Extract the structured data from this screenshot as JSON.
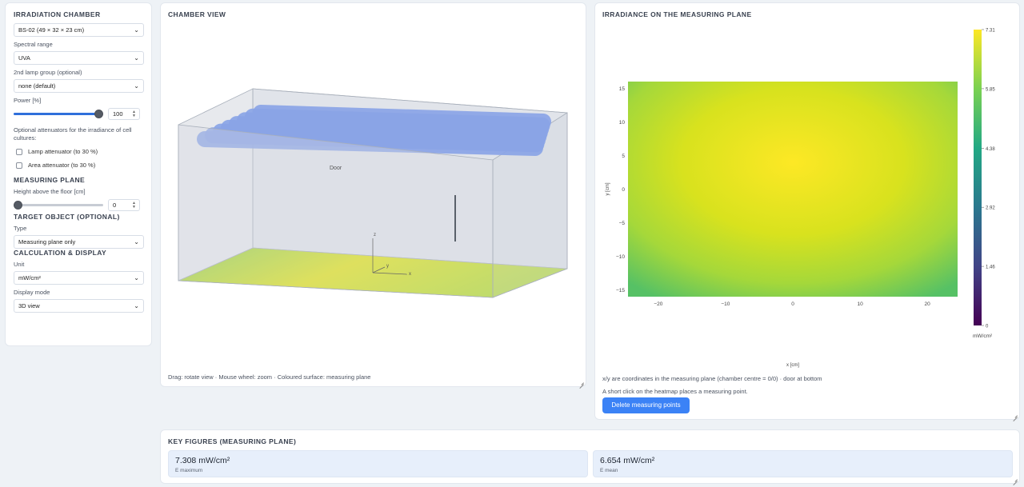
{
  "sidebar": {
    "chamber_title": "IRRADIATION CHAMBER",
    "chamber_value": "BS-02 (49 × 32 × 23 cm)",
    "spectral_label": "Spectral range",
    "spectral_value": "UVA",
    "lamp_group_label": "2nd lamp group (optional)",
    "lamp_group_value": "none (default)",
    "power_label": "Power [%]",
    "power_value": "100",
    "power_fraction": 1.0,
    "attenuators_label": "Optional attenuators for the irradiance of cell cultures:",
    "lamp_attenuator": "Lamp attenuator (to 30 %)",
    "area_attenuator": "Area attenuator (to 30 %)",
    "measuring_plane_title": "MEASURING PLANE",
    "height_label": "Height above the floor [cm]",
    "height_value": "0",
    "height_fraction": 0.0,
    "target_title": "TARGET OBJECT (OPTIONAL)",
    "type_label": "Type",
    "type_value": "Measuring plane only",
    "calc_title": "CALCULATION & DISPLAY",
    "unit_label": "Unit",
    "unit_value": "mW/cm²",
    "display_mode_label": "Display mode",
    "display_mode_value": "3D view",
    "chevron_icon": "chevron-down-icon"
  },
  "chamber": {
    "title": "CHAMBER VIEW",
    "door_label": "Door",
    "axis_x": "x",
    "axis_y": "y",
    "axis_z": "z",
    "note": "Drag: rotate view · Mouse wheel: zoom · Coloured surface: measuring plane",
    "lamp_color": "#8aa4e6",
    "box_color": "#d5d9e2"
  },
  "heatmap": {
    "title": "IRRADIANCE ON THE MEASURING PLANE",
    "xlabel": "x [cm]",
    "ylabel": "y [cm]",
    "colorbar_unit": "mW/cm²",
    "note1": "x/y are coordinates in the measuring plane (chamber centre = 0/0) · door at bottom",
    "note2": "A short click on the heatmap places a measuring point.",
    "delete_button": "Delete measuring points"
  },
  "chart_data": {
    "type": "heatmap",
    "x_range": [
      -24.5,
      24.5
    ],
    "y_range": [
      -16,
      16
    ],
    "x_ticks": [
      -20,
      -10,
      0,
      10,
      20
    ],
    "y_ticks": [
      -15,
      -10,
      -5,
      0,
      5,
      10,
      15
    ],
    "x_tick_labels": [
      "−20",
      "−10",
      "0",
      "10",
      "20"
    ],
    "y_tick_labels": [
      "−15",
      "−10",
      "−5",
      "0",
      "5",
      "10",
      "15"
    ],
    "z_range": [
      0,
      7.31
    ],
    "colorbar_ticks": [
      0,
      1.46,
      2.92,
      4.38,
      5.85,
      7.31
    ],
    "colorbar_tick_labels": [
      "0",
      "1.46",
      "2.92",
      "4.38",
      "5.85",
      "7.31"
    ],
    "colorscale": "viridis",
    "peak": {
      "x": 0,
      "y": 4,
      "value": 7.31
    },
    "corner_values": {
      "bottom_left": 5.9,
      "bottom_right": 5.7,
      "top_left": 6.3,
      "top_right": 6.2
    }
  },
  "key_figures": {
    "title": "KEY FIGURES (MEASURING PLANE)",
    "max_value": "7.308 mW/cm²",
    "max_label": "E maximum",
    "mean_value": "6.654 mW/cm²",
    "mean_label": "E mean"
  }
}
